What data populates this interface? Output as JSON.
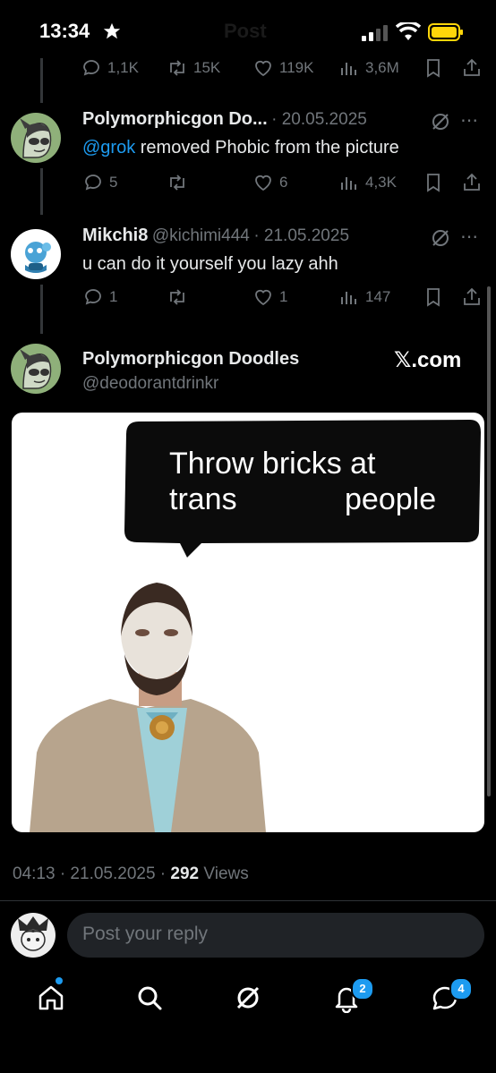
{
  "status_bar": {
    "time": "13:34"
  },
  "header": {
    "ghost_title": "Post"
  },
  "top_actions": {
    "replies": "1,1K",
    "reposts": "15K",
    "likes": "119K",
    "views": "3,6M"
  },
  "tweets": [
    {
      "name": "Polymorphicgon Do...",
      "handle": "",
      "date": "· 20.05.2025",
      "mention": "@grok",
      "text": " removed Phobic from the picture",
      "replies": "5",
      "reposts": "",
      "likes": "6",
      "views": "4,3K"
    },
    {
      "name": "Mikchi8",
      "handle": "@kichimi444",
      "date": "· 21.05.2025",
      "text": "u can do it yourself you lazy ahh",
      "replies": "1",
      "reposts": "",
      "likes": "1",
      "views": "147"
    }
  ],
  "main_post": {
    "name": "Polymorphicgon Doodles",
    "handle": "@deodorantdrinkr",
    "brand": "𝕏.com",
    "image_bubble_line1": "Throw bricks at",
    "image_bubble_line2_left": "trans",
    "image_bubble_line2_right": "people",
    "timestamp": "04:13 · 21.05.2025 · ",
    "views_count": "292",
    "views_label": " Views"
  },
  "reply": {
    "placeholder": "Post your reply"
  },
  "bottom_nav": {
    "notifications_badge": "2",
    "messages_badge": "4"
  },
  "colors": {
    "accent": "#1d9bf0",
    "muted": "#71767b",
    "background": "#000000"
  }
}
